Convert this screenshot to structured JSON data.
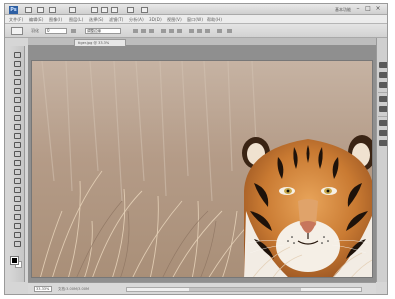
{
  "app": {
    "logo_text": "Ps",
    "workspace_label": "基本功能",
    "window_buttons": [
      "–",
      "□",
      "×"
    ]
  },
  "menu": {
    "items": [
      "文件(F)",
      "编辑(E)",
      "图像(I)",
      "图层(L)",
      "选择(S)",
      "滤镜(T)",
      "分析(A)",
      "3D(D)",
      "视图(V)",
      "窗口(W)",
      "帮助(H)"
    ]
  },
  "options": {
    "size_label": "羽化",
    "size_value": "0",
    "style_label": "调整边缘"
  },
  "document": {
    "tab_title": "tiger.jpg @ 33.3%"
  },
  "status": {
    "zoom": "33.33%",
    "info": "文档:3.00M/3.00M"
  },
  "icons": {
    "ps_logo": "photoshop-logo",
    "minimize": "minimize-icon",
    "maximize": "maximize-icon",
    "close": "close-icon"
  },
  "colors": {
    "foreground": "#000000",
    "background": "#ffffff",
    "canvas_grass": "#b8a08a"
  }
}
